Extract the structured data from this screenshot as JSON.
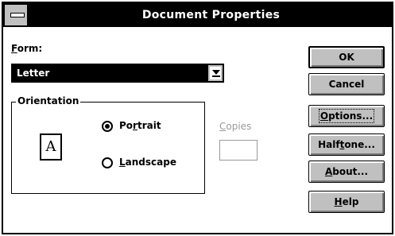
{
  "window": {
    "title": "Document Properties"
  },
  "form": {
    "label_underlined": "F",
    "label_rest": "orm:",
    "selected_value": "Letter"
  },
  "orientation": {
    "group_label": "Orientation",
    "portrait": {
      "before": "Po",
      "underlined": "r",
      "after": "trait",
      "selected": true
    },
    "landscape": {
      "before": "",
      "underlined": "L",
      "after": "andscape",
      "selected": false
    },
    "icon_glyph": "A"
  },
  "copies": {
    "label_underlined": "C",
    "label_rest": "opies",
    "value": ""
  },
  "buttons": {
    "ok": "OK",
    "cancel": "Cancel",
    "options": {
      "underlined": "O",
      "rest": "ptions..."
    },
    "halftone": {
      "before": "Half",
      "underlined": "t",
      "after": "one..."
    },
    "about": {
      "underlined": "A",
      "rest": "bout..."
    },
    "help": {
      "underlined": "H",
      "rest": "elp"
    }
  }
}
